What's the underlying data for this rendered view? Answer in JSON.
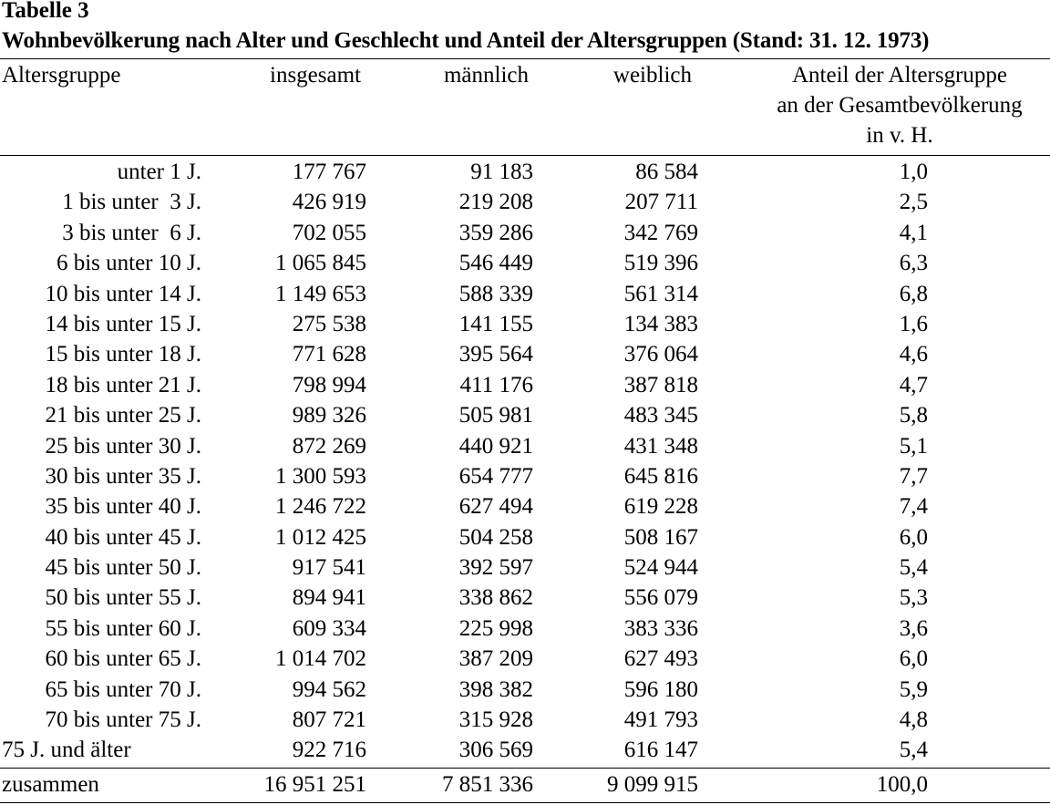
{
  "table_label": "Tabelle 3",
  "title": "Wohnbevölkerung nach Alter und Geschlecht und Anteil der Altersgruppen (Stand: 31. 12. 1973)",
  "headers": {
    "age_group": "Altersgruppe",
    "total": "insgesamt",
    "male": "männlich",
    "female": "weiblich",
    "share_line1": "Anteil der Altersgruppe",
    "share_line2": "an der Gesamtbevölkerung",
    "share_line3": "in v. H."
  },
  "rows": [
    {
      "age": "unter 1 J.",
      "total": "177 767",
      "male": "91 183",
      "female": "86 584",
      "share": "1,0"
    },
    {
      "age": "1 bis unter  3 J.",
      "total": "426 919",
      "male": "219 208",
      "female": "207 711",
      "share": "2,5"
    },
    {
      "age": "3 bis unter  6 J.",
      "total": "702 055",
      "male": "359 286",
      "female": "342 769",
      "share": "4,1"
    },
    {
      "age": "6 bis unter 10 J.",
      "total": "1 065 845",
      "male": "546 449",
      "female": "519 396",
      "share": "6,3"
    },
    {
      "age": "10 bis unter 14 J.",
      "total": "1 149 653",
      "male": "588 339",
      "female": "561 314",
      "share": "6,8"
    },
    {
      "age": "14 bis unter 15 J.",
      "total": "275 538",
      "male": "141 155",
      "female": "134 383",
      "share": "1,6"
    },
    {
      "age": "15 bis unter 18 J.",
      "total": "771 628",
      "male": "395 564",
      "female": "376 064",
      "share": "4,6"
    },
    {
      "age": "18 bis unter 21 J.",
      "total": "798 994",
      "male": "411 176",
      "female": "387 818",
      "share": "4,7"
    },
    {
      "age": "21 bis unter 25 J.",
      "total": "989 326",
      "male": "505 981",
      "female": "483 345",
      "share": "5,8"
    },
    {
      "age": "25 bis unter 30 J.",
      "total": "872 269",
      "male": "440 921",
      "female": "431 348",
      "share": "5,1"
    },
    {
      "age": "30 bis unter 35 J.",
      "total": "1 300 593",
      "male": "654 777",
      "female": "645 816",
      "share": "7,7"
    },
    {
      "age": "35 bis unter 40 J.",
      "total": "1 246 722",
      "male": "627 494",
      "female": "619 228",
      "share": "7,4"
    },
    {
      "age": "40 bis unter 45 J.",
      "total": "1 012 425",
      "male": "504 258",
      "female": "508 167",
      "share": "6,0"
    },
    {
      "age": "45 bis unter 50 J.",
      "total": "917 541",
      "male": "392 597",
      "female": "524 944",
      "share": "5,4"
    },
    {
      "age": "50 bis unter 55 J.",
      "total": "894 941",
      "male": "338 862",
      "female": "556 079",
      "share": "5,3"
    },
    {
      "age": "55 bis unter 60 J.",
      "total": "609 334",
      "male": "225 998",
      "female": "383 336",
      "share": "3,6"
    },
    {
      "age": "60 bis unter 65 J.",
      "total": "1 014 702",
      "male": "387 209",
      "female": "627 493",
      "share": "6,0"
    },
    {
      "age": "65 bis unter 70 J.",
      "total": "994 562",
      "male": "398 382",
      "female": "596 180",
      "share": "5,9"
    },
    {
      "age": "70 bis unter 75 J.",
      "total": "807 721",
      "male": "315 928",
      "female": "491 793",
      "share": "4,8"
    },
    {
      "age": "75 J. und älter",
      "total": "922 716",
      "male": "306 569",
      "female": "616 147",
      "share": "5,4"
    }
  ],
  "total_row": {
    "label": "zusammen",
    "total": "16 951 251",
    "male": "7 851 336",
    "female": "9 099 915",
    "share": "100,0"
  }
}
